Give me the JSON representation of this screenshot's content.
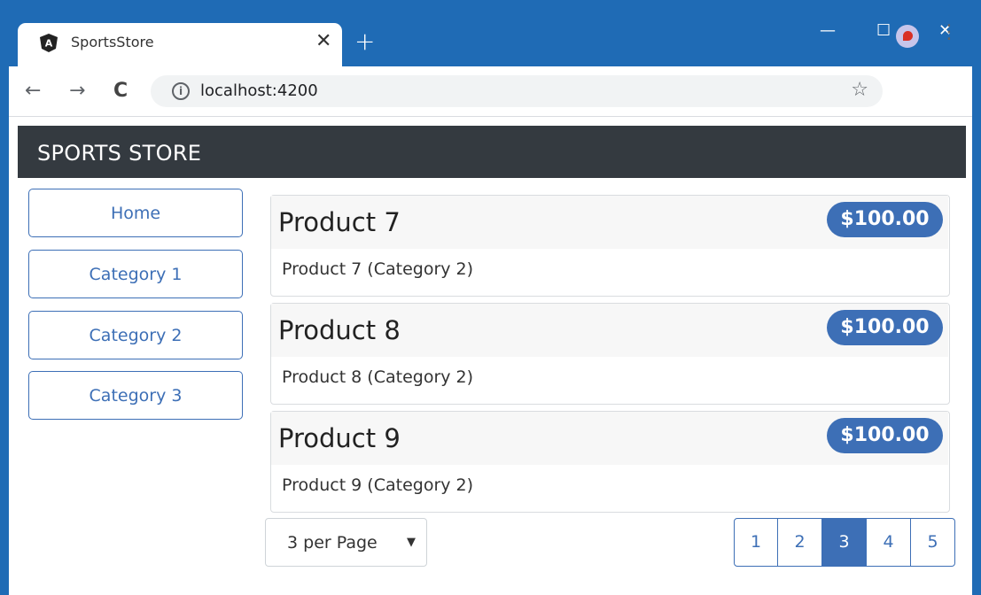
{
  "browser": {
    "tab_title": "SportsStore",
    "favicon_letter": "A",
    "close_glyph": "✕",
    "new_tab_glyph": "+",
    "minimize_glyph": "—",
    "maximize_glyph": "☐",
    "window_close_glyph": "✕",
    "back_glyph": "←",
    "forward_glyph": "→",
    "reload_glyph": "C",
    "info_glyph": "i",
    "url": "localhost:4200",
    "star_glyph": "☆",
    "menu_glyph": "⋮"
  },
  "page": {
    "brand": "SPORTS STORE",
    "categories": [
      "Home",
      "Category 1",
      "Category 2",
      "Category 3"
    ],
    "products": [
      {
        "name": "Product 7",
        "price": "$100.00",
        "description": "Product 7 (Category 2)"
      },
      {
        "name": "Product 8",
        "price": "$100.00",
        "description": "Product 8 (Category 2)"
      },
      {
        "name": "Product 9",
        "price": "$100.00",
        "description": "Product 9 (Category 2)"
      }
    ],
    "per_page": "3 per Page",
    "select_caret": "▼",
    "pages": [
      "1",
      "2",
      "3",
      "4",
      "5"
    ],
    "active_page": "3"
  },
  "colors": {
    "accent": "#3d6fb6",
    "navbar": "#343a40",
    "chrome_frame": "#1f6bb5"
  }
}
